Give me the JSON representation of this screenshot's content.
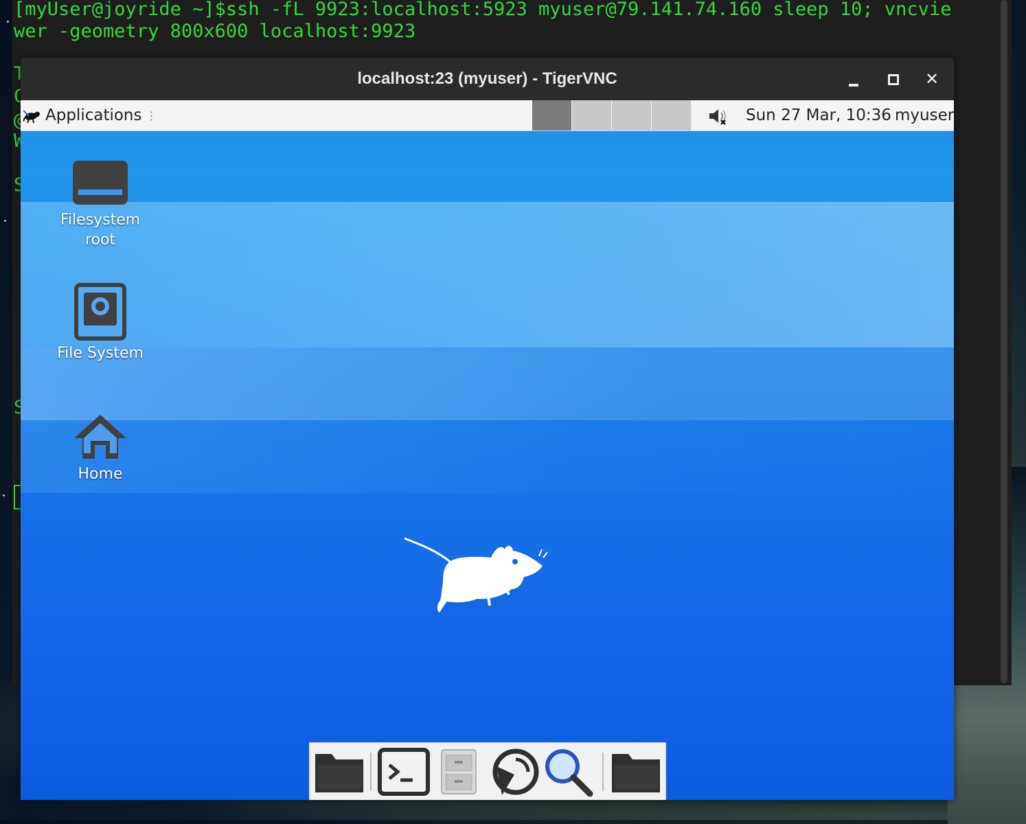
{
  "terminal": {
    "line1": "[myUser@joyride ~]$ssh -fL 9923:localhost:5923 myuser@79.141.74.160 sleep 10; vncvie",
    "line2": "wer -geometry 800x600 localhost:9923",
    "hidden_fragments": [
      "T",
      "C",
      "@",
      "W",
      "S",
      "S"
    ]
  },
  "vnc_window": {
    "title": "localhost:23 (myuser) - TigerVNC",
    "buttons": [
      "minimize",
      "maximize",
      "close"
    ],
    "close_glyph": "✕"
  },
  "panel": {
    "applications_label": "Applications",
    "applications_handle": "⋮",
    "workspaces": 4,
    "active_workspace": 1,
    "volume_icon": "speaker-muted-icon",
    "clock": "Sun 27 Mar, 10:36",
    "user": "myuser"
  },
  "desktop": {
    "icons": [
      {
        "label_line1": "Filesystem",
        "label_line2": "root",
        "icon": "drive-icon"
      },
      {
        "label_line1": "File System",
        "icon": "harddisk-icon"
      },
      {
        "label_line1": "Home",
        "icon": "home-icon"
      }
    ]
  },
  "dock": {
    "items": [
      "folder-icon",
      "terminal-icon",
      "file-cabinet-icon",
      "web-browser-icon",
      "search-icon",
      "folder-icon"
    ]
  },
  "colors": {
    "terminal_text": "#34d83b",
    "desktop_blue": "#1466e6",
    "titlebar": "#2b2b2b"
  }
}
